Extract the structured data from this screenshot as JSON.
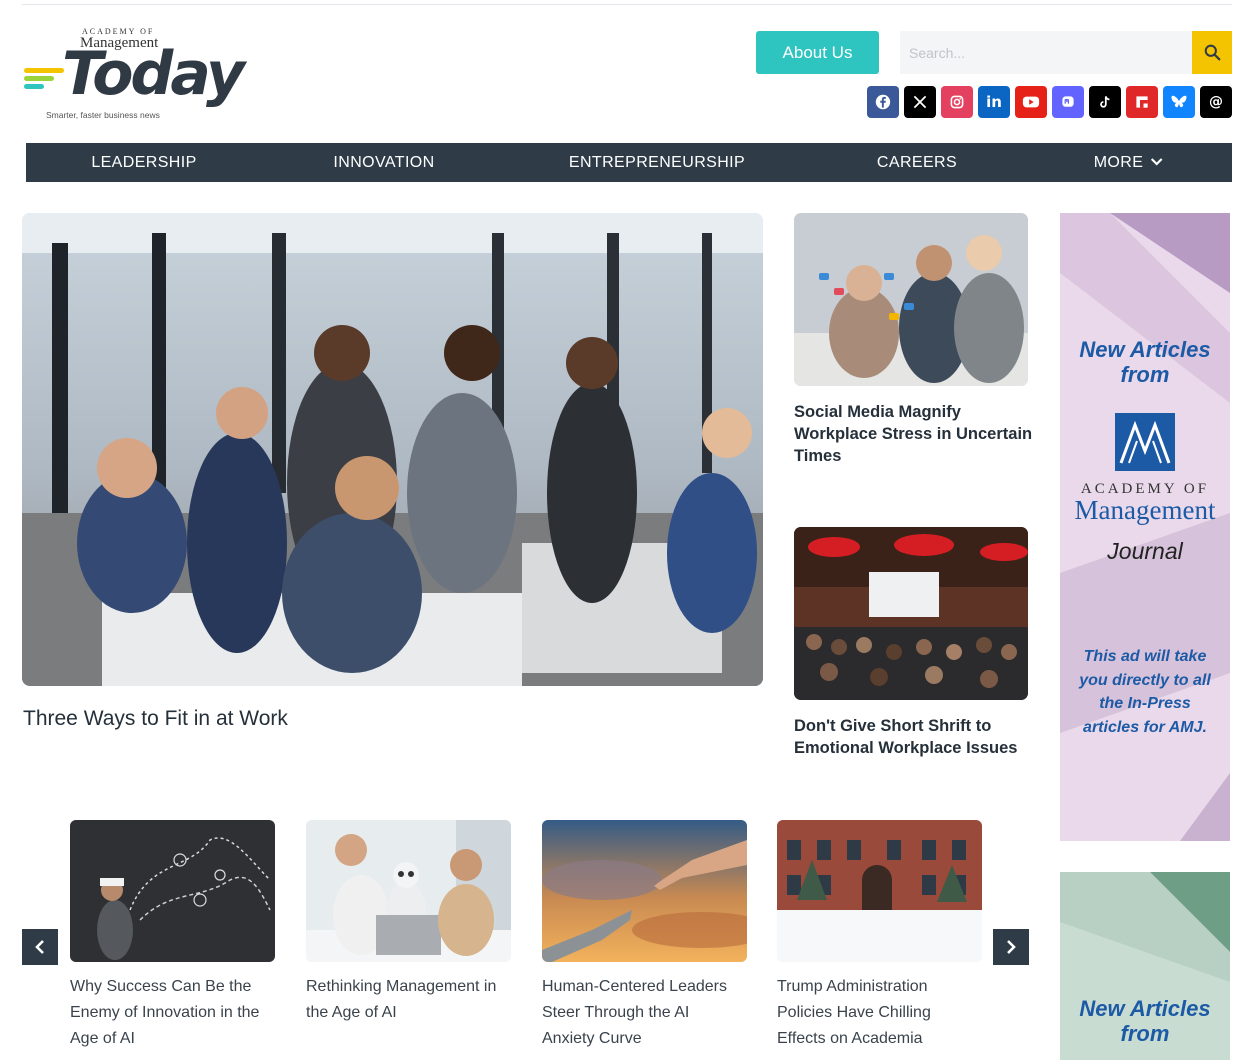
{
  "logo": {
    "academy_text": "ACADEMY OF",
    "management_text": "Management",
    "today_text": "Today",
    "tagline": "Smarter, faster business news"
  },
  "header": {
    "about_label": "About Us",
    "search_placeholder": "Search...",
    "search_icon": "search-icon",
    "socials": [
      {
        "icon": "facebook-icon",
        "color": "#3b5998"
      },
      {
        "icon": "x-icon",
        "color": "#000000"
      },
      {
        "icon": "instagram-icon",
        "color": "#e4405f"
      },
      {
        "icon": "linkedin-icon",
        "color": "#0a66c2"
      },
      {
        "icon": "youtube-icon",
        "color": "#e62117"
      },
      {
        "icon": "mastodon-icon",
        "color": "#6364ff"
      },
      {
        "icon": "tiktok-icon",
        "color": "#000000"
      },
      {
        "icon": "flipboard-icon",
        "color": "#e12828"
      },
      {
        "icon": "bluesky-icon",
        "color": "#1185fe"
      },
      {
        "icon": "threads-icon",
        "color": "#000000"
      }
    ]
  },
  "nav": {
    "items": [
      {
        "label": "LEADERSHIP"
      },
      {
        "label": "INNOVATION"
      },
      {
        "label": "ENTREPRENEURSHIP"
      },
      {
        "label": "CAREERS"
      },
      {
        "label": "MORE"
      }
    ]
  },
  "featured": {
    "main": {
      "title": "Three Ways to Fit in at Work"
    },
    "side": [
      {
        "title": "Social Media Magnify Workplace Stress in Uncertain Times"
      },
      {
        "title": "Don't Give Short Shrift to Emotional Workplace Issues"
      }
    ]
  },
  "ads": [
    {
      "headline": "New Articles from",
      "brand_top": "ACADEMY OF",
      "brand_bottom": "Management",
      "journal": "Journal",
      "body": "This ad will take you directly to all the In-Press articles for AMJ."
    },
    {
      "headline": "New Articles from"
    }
  ],
  "carousel": {
    "prev_icon": "chevron-left-icon",
    "next_icon": "chevron-right-icon",
    "items": [
      {
        "title": "Why Success Can Be the Enemy of Innovation in the Age of AI"
      },
      {
        "title": "Rethinking Management in the Age of AI"
      },
      {
        "title": "Human-Centered Leaders Steer Through the AI Anxiety Curve"
      },
      {
        "title": "Trump Administration Policies Have Chilling Effects on Academia"
      }
    ]
  },
  "colors": {
    "accent_teal": "#2ec4c0",
    "accent_yellow": "#f5c400",
    "nav_bg": "#2f3c47",
    "brand_blue": "#1d5aa6"
  }
}
